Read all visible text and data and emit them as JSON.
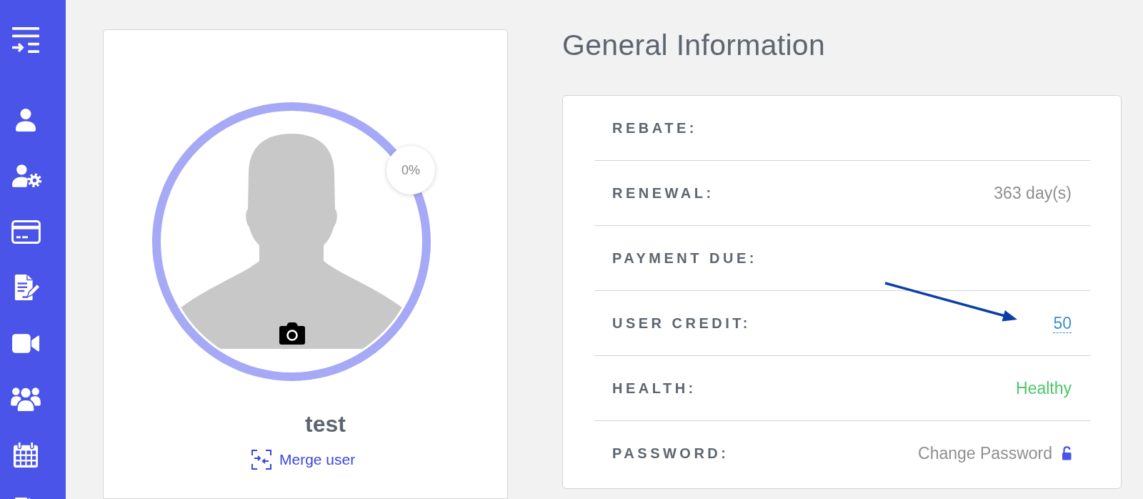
{
  "profile": {
    "completion": "0%",
    "name": "test",
    "merge_link": "Merge user"
  },
  "general_information": {
    "title": "General Information",
    "rows": [
      {
        "label": "REBATE:"
      },
      {
        "label": "RENEWAL:",
        "kind": "text",
        "value": "363 day(s)"
      },
      {
        "label": "PAYMENT DUE:"
      },
      {
        "label": "USER CREDIT:",
        "kind": "editable",
        "value": "50"
      },
      {
        "label": "HEALTH:",
        "kind": "status",
        "value": "Healthy",
        "color": "#4cc76a"
      },
      {
        "label": "PASSWORD:",
        "kind": "action",
        "value": "Change Password"
      }
    ]
  }
}
